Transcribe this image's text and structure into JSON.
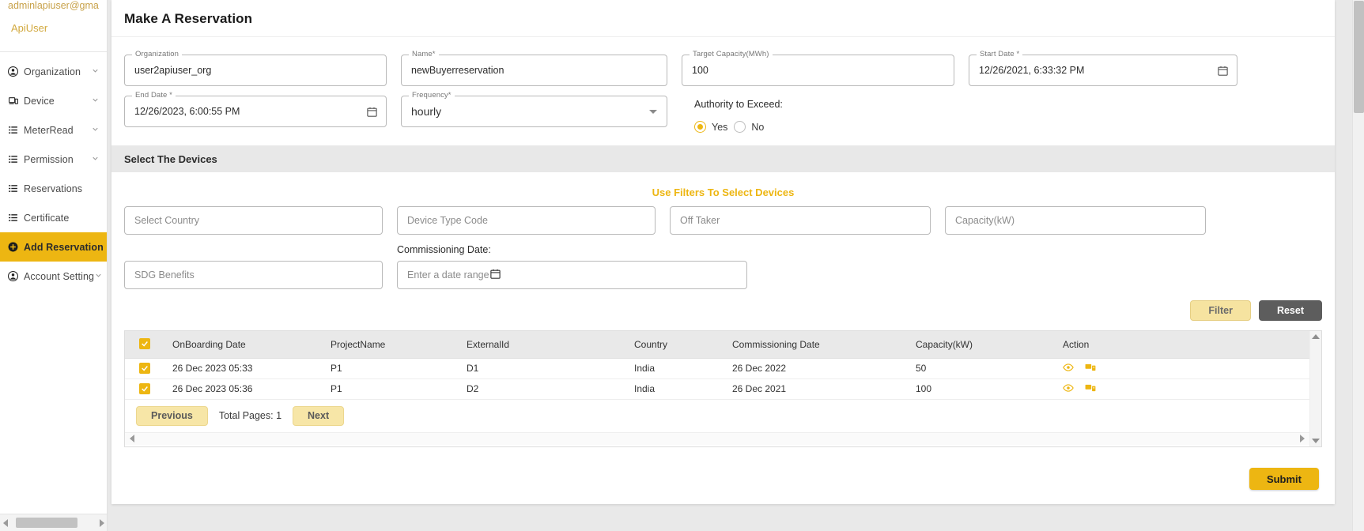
{
  "sidebar": {
    "user_email": "adminlapiuser@gmail.c",
    "user_name": "ApiUser",
    "items": [
      {
        "label": "Organization",
        "icon": "account-circle-icon",
        "chevron": true
      },
      {
        "label": "Device",
        "icon": "device-icon",
        "chevron": true
      },
      {
        "label": "MeterRead",
        "icon": "list-icon",
        "chevron": true
      },
      {
        "label": "Permission",
        "icon": "list-icon",
        "chevron": true
      },
      {
        "label": "Reservations",
        "icon": "list-icon",
        "chevron": false
      },
      {
        "label": "Certificate",
        "icon": "list-icon",
        "chevron": false
      },
      {
        "label": "Add Reservation",
        "icon": "plus-circle-icon",
        "chevron": false,
        "active": true
      },
      {
        "label": "Account Setting",
        "icon": "account-circle-icon",
        "chevron": true
      }
    ]
  },
  "page": {
    "title": "Make A Reservation"
  },
  "form": {
    "organization": {
      "label": "Organization",
      "value": "user2apiuser_org"
    },
    "name": {
      "label": "Name*",
      "value": "newBuyerreservation"
    },
    "target_capacity": {
      "label": "Target Capacity(MWh)",
      "value": "100"
    },
    "start_date": {
      "label": "Start Date *",
      "value": "12/26/2021, 6:33:32 PM"
    },
    "end_date": {
      "label": "End Date *",
      "value": "12/26/2023, 6:00:55 PM"
    },
    "frequency": {
      "label": "Frequency*",
      "value": "hourly"
    },
    "authority": {
      "label": "Authority to Exceed:",
      "yes": "Yes",
      "no": "No",
      "selected": "Yes"
    }
  },
  "devices": {
    "section_title": "Select The Devices",
    "filters_title": "Use Filters To Select Devices",
    "country_placeholder": "Select Country",
    "device_type_placeholder": "Device Type Code",
    "off_taker_placeholder": "Off Taker",
    "capacity_placeholder": "Capacity(kW)",
    "sdg_placeholder": "SDG Benefits",
    "commissioning_label": "Commissioning Date:",
    "date_range_placeholder": "Enter a date range",
    "filter_button": "Filter",
    "reset_button": "Reset"
  },
  "table": {
    "columns": [
      "OnBoarding Date",
      "ProjectName",
      "ExternalId",
      "Country",
      "Commissioning Date",
      "Capacity(kW)",
      "Action"
    ],
    "header_checked": true,
    "rows": [
      {
        "checked": true,
        "onboarding_date": "26 Dec 2023 05:33",
        "project_name": "P1",
        "external_id": "D1",
        "country": "India",
        "commissioning_date": "26 Dec 2022",
        "capacity": "50"
      },
      {
        "checked": true,
        "onboarding_date": "26 Dec 2023 05:36",
        "project_name": "P1",
        "external_id": "D2",
        "country": "India",
        "commissioning_date": "26 Dec 2021",
        "capacity": "100"
      }
    ]
  },
  "pagination": {
    "previous": "Previous",
    "total_pages": "Total Pages: 1",
    "next": "Next"
  },
  "actions": {
    "submit": "Submit"
  },
  "colors": {
    "accent": "#edb612",
    "accent_light": "#f7e6a7",
    "reset_gray": "#5d5d5d"
  }
}
